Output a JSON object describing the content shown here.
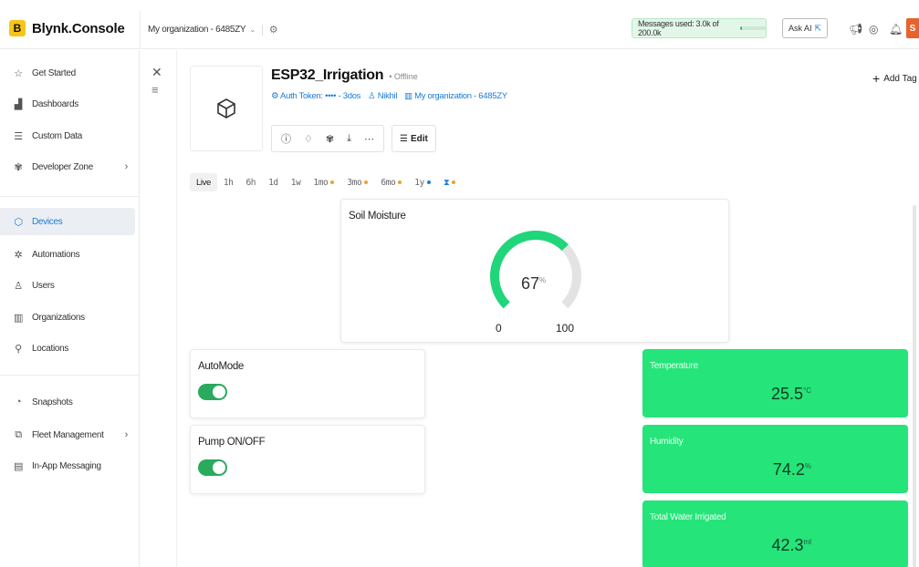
{
  "brand": {
    "badge": "B",
    "name": "Blynk.Console"
  },
  "header": {
    "org": "My organization - 6485ZY",
    "messages": "Messages used: 3.0k of 200.0k",
    "messages_fraction": 0.015,
    "ask_ai": "Ask AI",
    "avatar": "S"
  },
  "sidebar": {
    "items": [
      {
        "label": "Get Started",
        "icon": "star-icon"
      },
      {
        "label": "Dashboards",
        "icon": "bar-chart-icon"
      },
      {
        "label": "Custom Data",
        "icon": "database-icon"
      },
      {
        "label": "Developer Zone",
        "icon": "developer-icon"
      },
      {
        "label": "Devices",
        "icon": "cube-icon"
      },
      {
        "label": "Automations",
        "icon": "automation-icon"
      },
      {
        "label": "Users",
        "icon": "users-icon"
      },
      {
        "label": "Organizations",
        "icon": "building-icon"
      },
      {
        "label": "Locations",
        "icon": "pin-icon"
      },
      {
        "label": "Snapshots",
        "icon": "snapshot-icon"
      },
      {
        "label": "Fleet Management",
        "icon": "fleet-icon"
      },
      {
        "label": "In-App Messaging",
        "icon": "message-icon"
      }
    ]
  },
  "device": {
    "name": "ESP32_Irrigation",
    "status": "• Offline",
    "auth_token": "Auth Token: •••• - 3dos",
    "owner": "Nikhil",
    "org": "My organization - 6485ZY",
    "edit": "Edit",
    "add_tag": "Add Tag"
  },
  "time_tabs": [
    "Live",
    "1h",
    "6h",
    "1d",
    "1w",
    "1mo",
    "3mo",
    "6mo",
    "1y"
  ],
  "widgets": {
    "soil": {
      "title": "Soil Moisture",
      "value": "67",
      "unit": "%",
      "min": "0",
      "max": "100",
      "fraction": 0.67
    },
    "automode": {
      "title": "AutoMode",
      "on": true
    },
    "pump": {
      "title": "Pump ON/OFF",
      "on": true
    },
    "temperature": {
      "title": "Temperature",
      "value": "25.5",
      "unit": "°C"
    },
    "humidity": {
      "title": "Humidity",
      "value": "74.2",
      "unit": "%"
    },
    "water": {
      "title": "Total Water Irrigated",
      "value": "42.3",
      "unit": "ml"
    }
  },
  "colors": {
    "accent": "#1b7cd6",
    "green": "#25e47a",
    "gauge": "#20d67a",
    "toggle": "#2aaa5c",
    "brand_yellow": "#f5c518"
  }
}
